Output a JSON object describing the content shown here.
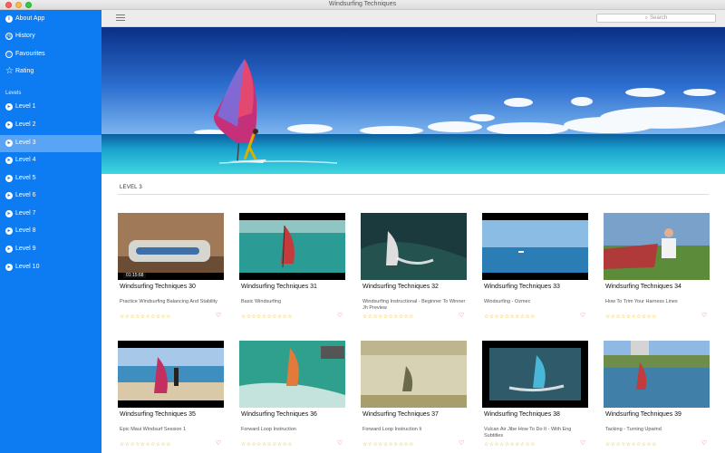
{
  "window": {
    "title": "Windsurfing Techniques"
  },
  "sidebar": {
    "top_items": [
      {
        "label": "About App",
        "icon": "info-icon"
      },
      {
        "label": "History",
        "icon": "clock-icon"
      },
      {
        "label": "Favourites",
        "icon": "heart-icon"
      },
      {
        "label": "Rating",
        "icon": "star-icon"
      }
    ],
    "levels_header": "Levels",
    "levels": [
      {
        "label": "Level 1"
      },
      {
        "label": "Level 2"
      },
      {
        "label": "Level 3",
        "active": true
      },
      {
        "label": "Level 4"
      },
      {
        "label": "Level 5"
      },
      {
        "label": "Level 6"
      },
      {
        "label": "Level 7"
      },
      {
        "label": "Level 8"
      },
      {
        "label": "Level 9"
      },
      {
        "label": "Level 10"
      }
    ],
    "accent": "#0d7cf2"
  },
  "toolbar": {
    "search_placeholder": "Search"
  },
  "section": {
    "title": "LEVEL 3"
  },
  "videos": [
    {
      "title": "Windsurfing Techniques 30",
      "subtitle": "Practice Windsurfing Balancing And Stability",
      "duration": "01:15:68",
      "stars": "☆☆☆☆☆☆☆☆☆☆"
    },
    {
      "title": "Windsurfing Techniques 31",
      "subtitle": "Basic Windsurfing",
      "stars": "☆☆☆☆☆☆☆☆☆☆"
    },
    {
      "title": "Windsurfing Techniques 32",
      "subtitle": "Windsurfing Instructional - Beginner To Winner Jh Preview",
      "stars": "☆☆☆☆☆☆☆☆☆☆"
    },
    {
      "title": "Windsurfing Techniques 33",
      "subtitle": "Windsurfing - Ozmec",
      "stars": "☆☆☆☆☆☆☆☆☆☆"
    },
    {
      "title": "Windsurfing Techniques 34",
      "subtitle": "How To Trim Your Harness Lines",
      "stars": "☆☆☆☆☆☆☆☆☆☆"
    },
    {
      "title": "Windsurfing Techniques 35",
      "subtitle": "Epic Maui Windsurf Session 1",
      "stars": "☆☆☆☆☆☆☆☆☆☆"
    },
    {
      "title": "Windsurfing Techniques 36",
      "subtitle": "Forward Loop Instruction",
      "stars": "☆☆☆☆☆☆☆☆☆☆"
    },
    {
      "title": "Windsurfing Techniques 37",
      "subtitle": "Forward Loop Instruction Ii",
      "stars": "☆☆☆☆☆☆☆☆☆☆"
    },
    {
      "title": "Windsurfing Techniques 38",
      "subtitle": "Vulcan Air Jibe How To Do It - With Eng Subtitles",
      "stars": "☆☆☆☆☆☆☆☆☆☆"
    },
    {
      "title": "Windsurfing Techniques 39",
      "subtitle": "Tacking - Turning Upwind",
      "stars": "☆☆☆☆☆☆☆☆☆☆"
    }
  ]
}
